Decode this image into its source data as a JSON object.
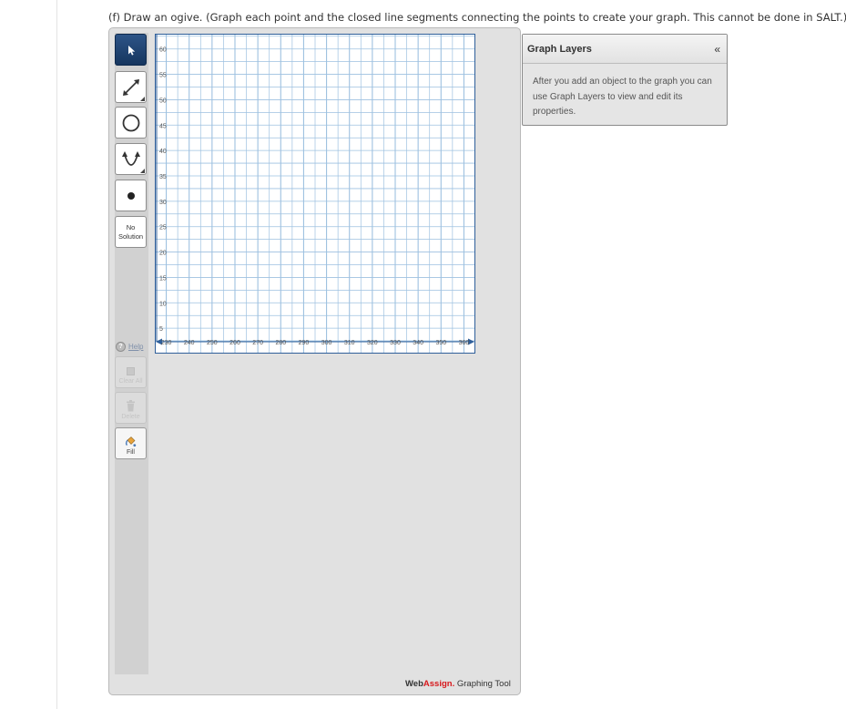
{
  "question": {
    "text": "(f) Draw an ogive. (Graph each point and the closed line segments connecting the points to create your graph. This cannot be done in SALT.)"
  },
  "toolbar": {
    "tools": [
      {
        "name": "pointer-tool",
        "icon": "arrow-pointer-icon",
        "active": true
      },
      {
        "name": "line-tool",
        "icon": "line-arrows-icon",
        "has_submenu": true
      },
      {
        "name": "circle-tool",
        "icon": "circle-icon"
      },
      {
        "name": "parabola-tool",
        "icon": "parabola-icon",
        "has_submenu": true
      },
      {
        "name": "point-tool",
        "icon": "point-icon"
      }
    ],
    "no_solution": {
      "line1": "No",
      "line2": "Solution"
    },
    "help_label": "Help",
    "clear_all_label": "Clear All",
    "delete_label": "Delete",
    "fill_label": "Fill"
  },
  "graph": {
    "x_ticks": [
      "230",
      "240",
      "250",
      "260",
      "270",
      "280",
      "290",
      "300",
      "310",
      "320",
      "330",
      "340",
      "350",
      "360"
    ],
    "y_ticks": [
      "60",
      "55",
      "50",
      "45",
      "40",
      "35",
      "30",
      "25",
      "20",
      "15",
      "10",
      "5"
    ],
    "x_range": [
      225,
      365
    ],
    "y_range": [
      0,
      63
    ],
    "x_major_step": 10,
    "y_major_step": 5,
    "grid_color": "#9ec1e0",
    "border_color": "#2f5f9a",
    "axis_color": "#2f5f9a"
  },
  "layers_panel": {
    "title": "Graph Layers",
    "collapse_glyph": "«",
    "body": "After you add an object to the graph you can use Graph Layers to view and edit its properties."
  },
  "branding": {
    "web": "Web",
    "assign": "Assign",
    "dot": ".",
    "tail": " Graphing Tool",
    "accent_color": "#d7191d"
  }
}
